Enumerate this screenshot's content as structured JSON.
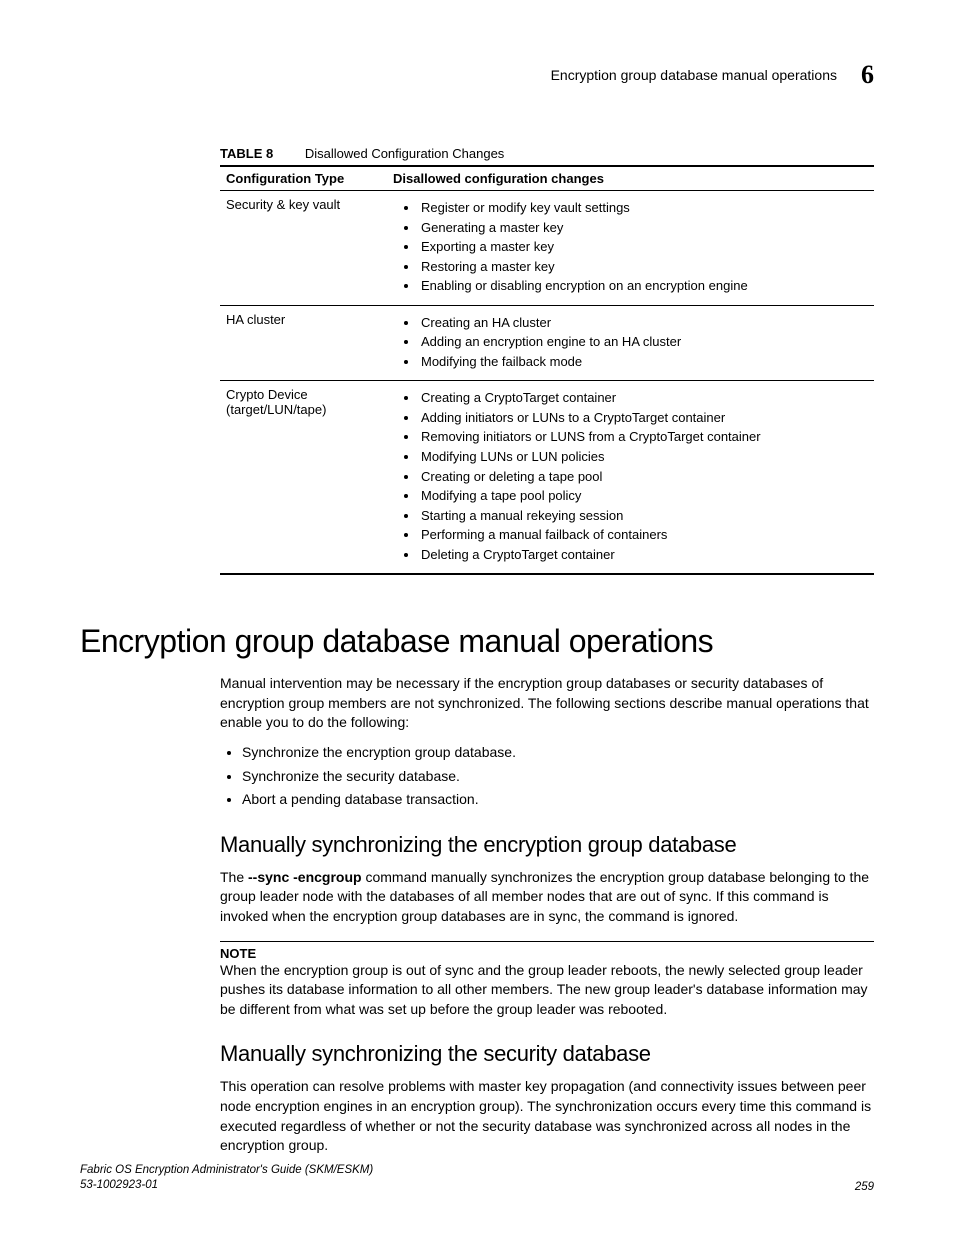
{
  "header": {
    "running_title": "Encryption group database manual operations",
    "chapter_number": "6"
  },
  "table": {
    "label": "TABLE 8",
    "title": "Disallowed Configuration Changes",
    "columns": [
      "Configuration Type",
      "Disallowed configuration changes"
    ],
    "rows": [
      {
        "type": "Security & key vault",
        "items": [
          "Register or modify key vault settings",
          "Generating a master key",
          "Exporting a master key",
          "Restoring a master key",
          "Enabling or disabling encryption on an encryption engine"
        ]
      },
      {
        "type": "HA cluster",
        "items": [
          "Creating an HA cluster",
          "Adding an encryption engine to an HA cluster",
          "Modifying the failback mode"
        ]
      },
      {
        "type_line1": "Crypto Device",
        "type_line2": "(target/LUN/tape)",
        "items": [
          "Creating a CryptoTarget container",
          "Adding initiators or LUNs to a CryptoTarget container",
          "Removing initiators or LUNS from a CryptoTarget container",
          "Modifying LUNs or LUN policies",
          "Creating or deleting a tape pool",
          "Modifying a tape pool policy",
          "Starting a manual rekeying session",
          "Performing a manual failback of containers",
          "Deleting a CryptoTarget container"
        ]
      }
    ]
  },
  "section": {
    "heading": "Encryption group database manual operations",
    "intro": "Manual intervention may be necessary if the encryption group databases or security databases of encryption group members are not synchronized. The following sections describe manual operations that enable you to do the following:",
    "intro_list": [
      "Synchronize the encryption group database.",
      "Synchronize the security database.",
      "Abort a pending database transaction."
    ],
    "sub1": {
      "heading": "Manually synchronizing the encryption group database",
      "para_pre": "The ",
      "cmd": "--sync -encgroup",
      "para_post": " command manually synchronizes the encryption group database belonging to the group leader node with the databases of all member nodes that are out of sync. If this command is invoked when the encryption group databases are in sync, the command is ignored.",
      "note_label": "NOTE",
      "note_text": "When the encryption group is out of sync and the group leader reboots, the newly selected group leader pushes its database information to all other members. The new group leader's database information may be different from what was set up before the group leader was rebooted."
    },
    "sub2": {
      "heading": "Manually synchronizing the security database",
      "para": "This operation can resolve problems with master key propagation (and connectivity issues between peer node encryption engines in an encryption group). The synchronization occurs every time this command is executed regardless of whether or not the security database was synchronized across all nodes in the encryption group."
    }
  },
  "footer": {
    "title": "Fabric OS Encryption Administrator's Guide (SKM/ESKM)",
    "docnum": "53-1002923-01",
    "page": "259"
  }
}
